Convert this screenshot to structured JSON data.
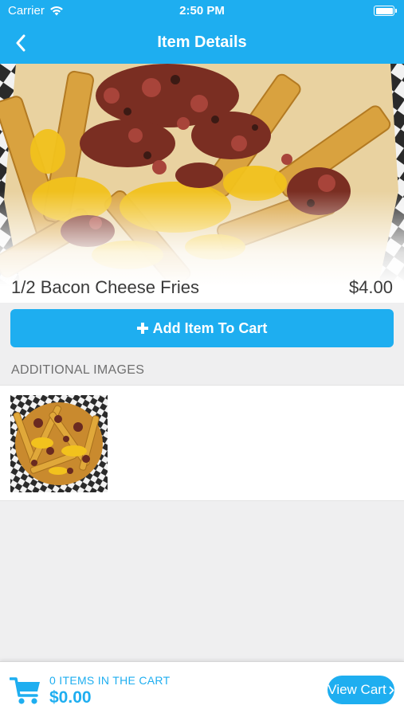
{
  "status_bar": {
    "carrier": "Carrier",
    "time": "2:50 PM"
  },
  "nav": {
    "title": "Item Details"
  },
  "item": {
    "name": "1/2 Bacon Cheese Fries",
    "price": "$4.00"
  },
  "actions": {
    "add_to_cart_label": "Add Item To Cart"
  },
  "additional_images": {
    "header": "ADDITIONAL IMAGES",
    "count": 1
  },
  "cart": {
    "count_label": "0 ITEMS IN THE CART",
    "total": "$0.00",
    "view_cart_label": "View Cart"
  },
  "colors": {
    "accent": "#1eaef0",
    "background": "#efeff0",
    "text": "#3a3a3a"
  },
  "icons": [
    "wifi-icon",
    "battery-icon",
    "back-chevron-icon",
    "plus-icon",
    "cart-icon",
    "chevron-right-icon"
  ]
}
